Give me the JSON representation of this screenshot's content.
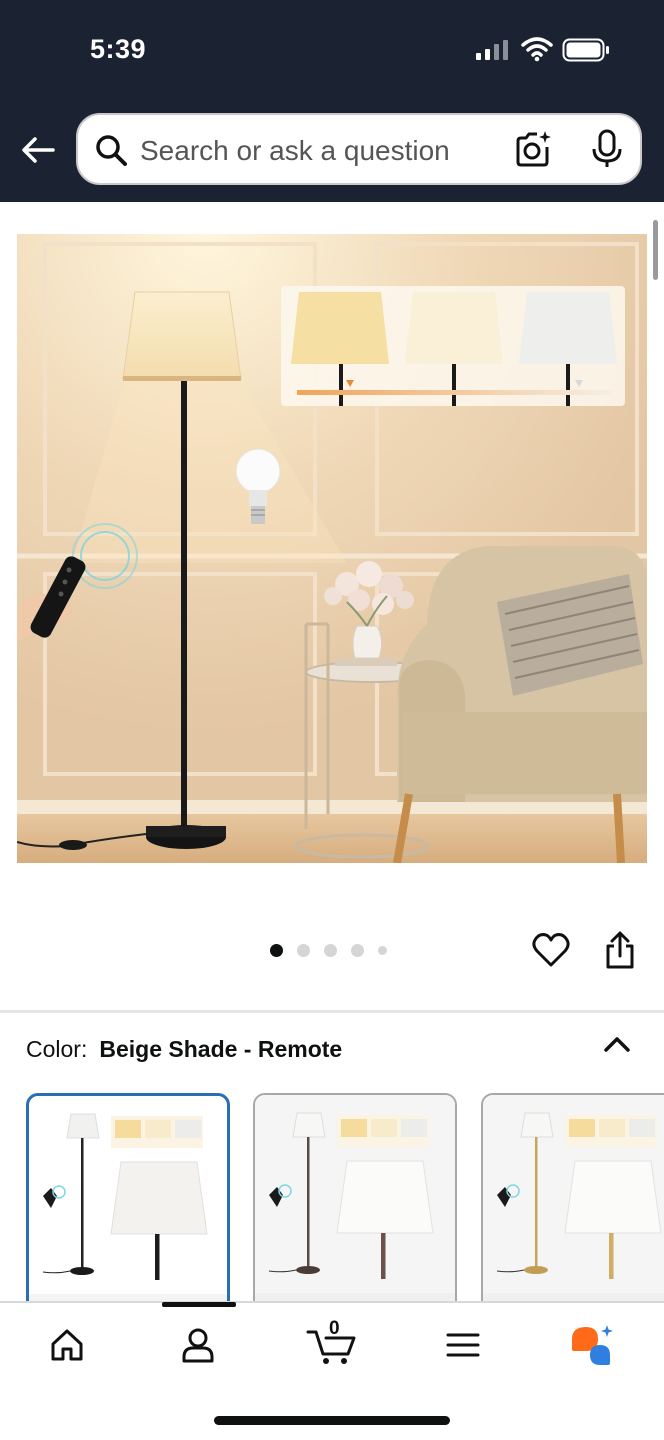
{
  "status_bar": {
    "time": "5:39"
  },
  "search": {
    "placeholder": "Search or ask a question"
  },
  "product": {
    "image_count": 5,
    "active_image_index": 0
  },
  "variation": {
    "label": "Color:",
    "selected_value": "Beige Shade - Remote",
    "options": [
      {
        "name": "black-pole",
        "selected": true
      },
      {
        "name": "bronze-pole",
        "selected": false
      },
      {
        "name": "gold-pole",
        "selected": false
      }
    ]
  },
  "bottom_nav": {
    "cart_count": "0",
    "items": [
      "home",
      "account",
      "cart",
      "menu",
      "rufus"
    ]
  },
  "colors": {
    "header_bg": "#1b2232",
    "selected_border": "#2a6fb0",
    "rufus_orange": "#ff6a1a",
    "rufus_blue": "#2f7fe0"
  }
}
